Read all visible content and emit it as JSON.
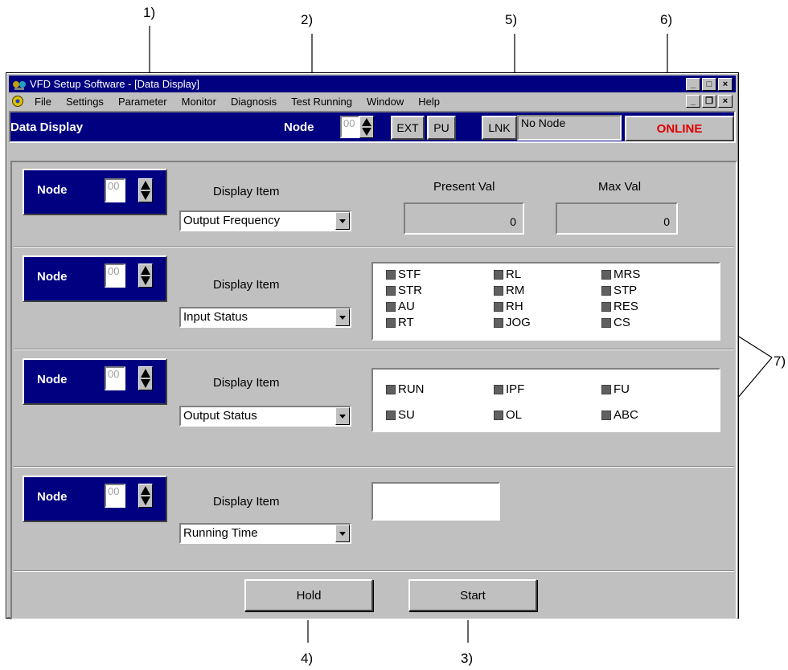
{
  "callouts": {
    "c1": "1)",
    "c2": "2)",
    "c3": "3)",
    "c4": "4)",
    "c5": "5)",
    "c6": "6)",
    "c7": "7)"
  },
  "window": {
    "title": "VFD Setup Software - [Data Display]"
  },
  "menu": [
    "File",
    "Settings",
    "Parameter",
    "Monitor",
    "Diagnosis",
    "Test Running",
    "Window",
    "Help"
  ],
  "toolbar": {
    "title": "Data Display",
    "node_label": "Node",
    "node_value": "00",
    "ext": "EXT",
    "pu": "PU",
    "lnk": "LNK",
    "status": "No Node",
    "online": "ONLINE"
  },
  "rows": [
    {
      "node_label": "Node",
      "node_value": "00",
      "display_label": "Display Item",
      "selected": "Output Frequency"
    },
    {
      "node_label": "Node",
      "node_value": "00",
      "display_label": "Display Item",
      "selected": "Input Status"
    },
    {
      "node_label": "Node",
      "node_value": "00",
      "display_label": "Display Item",
      "selected": "Output Status"
    },
    {
      "node_label": "Node",
      "node_value": "00",
      "display_label": "Display Item",
      "selected": "Running Time"
    }
  ],
  "values": {
    "present_label": "Present Val",
    "max_label": "Max Val",
    "present": "0",
    "max": "0"
  },
  "input_signals": [
    "STF",
    "STR",
    "AU",
    "RT",
    "RL",
    "RM",
    "RH",
    "JOG",
    "MRS",
    "STP",
    "RES",
    "CS"
  ],
  "output_signals": [
    "RUN",
    "SU",
    "IPF",
    "OL",
    "FU",
    "ABC"
  ],
  "buttons": {
    "hold": "Hold",
    "start": "Start"
  }
}
